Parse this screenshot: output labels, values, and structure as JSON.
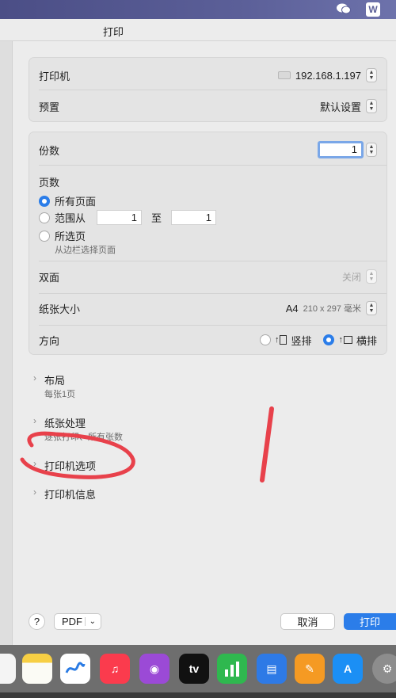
{
  "window": {
    "title": "打印"
  },
  "printer": {
    "label": "打印机",
    "value": "192.168.1.197"
  },
  "preset": {
    "label": "预置",
    "value": "默认设置"
  },
  "copies": {
    "label": "份数",
    "value": "1"
  },
  "pages": {
    "label": "页数",
    "all_label": "所有页面",
    "range_label": "范围从",
    "range_from": "1",
    "range_to_label": "至",
    "range_to": "1",
    "selected_label": "所选页",
    "selected_sub": "从边栏选择页面"
  },
  "duplex": {
    "label": "双面",
    "value": "关闭"
  },
  "paper": {
    "label": "纸张大小",
    "value": "A4",
    "dims": "210 x 297 毫米"
  },
  "orientation": {
    "label": "方向",
    "portrait": "竖排",
    "landscape": "横排",
    "selected": "landscape"
  },
  "sections": [
    {
      "title": "布局",
      "subtitle": "每张1页"
    },
    {
      "title": "纸张处理",
      "subtitle": "逐张打印、所有张数"
    },
    {
      "title": "打印机选项",
      "subtitle": ""
    },
    {
      "title": "打印机信息",
      "subtitle": ""
    }
  ],
  "footer": {
    "help": "?",
    "pdf": "PDF",
    "cancel": "取消",
    "print": "打印"
  },
  "dock_icons": [
    "reminders",
    "notes",
    "freeform",
    "music",
    "podcasts",
    "apple-tv",
    "numbers",
    "keynote",
    "pages",
    "app-store",
    "system-settings"
  ],
  "dock_labels": {
    "tv": "tv"
  },
  "colors": {
    "accent": "#2b7de9",
    "annotation": "#e8414b"
  }
}
